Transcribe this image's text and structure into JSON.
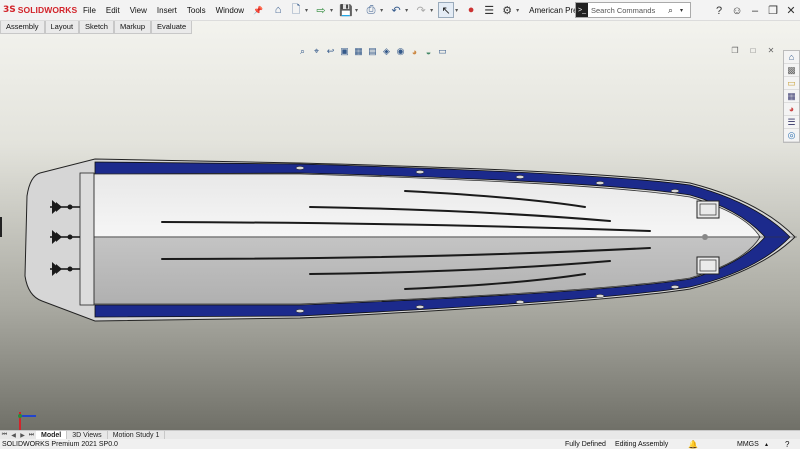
{
  "app": {
    "logo_text": "SOLIDWORKS",
    "document_name": "American Prede...",
    "search_placeholder": "Search Commands"
  },
  "menu": [
    "File",
    "Edit",
    "View",
    "Insert",
    "Tools",
    "Window"
  ],
  "command_tabs": [
    "Assembly",
    "Layout",
    "Sketch",
    "Markup",
    "Evaluate"
  ],
  "bottom_tabs": [
    {
      "label": "Model",
      "active": true
    },
    {
      "label": "3D Views",
      "active": false
    },
    {
      "label": "Motion Study 1",
      "active": false
    }
  ],
  "status": {
    "version": "SOLIDWORKS Premium 2021 SP0.0",
    "state": "Fully Defined",
    "mode": "Editing Assembly",
    "units": "MMGS"
  },
  "icons": {
    "toolbar": [
      "home-icon",
      "new-file-icon",
      "open-icon",
      "save-icon",
      "print-icon",
      "undo-icon",
      "redo-icon",
      "select-icon",
      "traffic-light-icon",
      "file-properties-icon",
      "options-icon"
    ],
    "heads_up": [
      "zoom-to-fit-icon",
      "zoom-to-area-icon",
      "previous-view-icon",
      "section-view-icon",
      "dynamic-annotation-icon",
      "view-orientation-icon",
      "display-style-icon",
      "hide-show-icon",
      "appearance-icon",
      "scene-icon",
      "view-settings-icon"
    ],
    "task_pane": [
      "solidworks-resources-icon",
      "design-library-icon",
      "file-explorer-icon",
      "view-palette-icon",
      "appearances-icon",
      "custom-properties-icon",
      "3dexperience-icon"
    ]
  },
  "colors": {
    "brand": "#d2232a",
    "hull_blue": "#1c2a8c",
    "deck_light": "#f2f2f2",
    "deck_shadow": "#bdbdbd"
  }
}
